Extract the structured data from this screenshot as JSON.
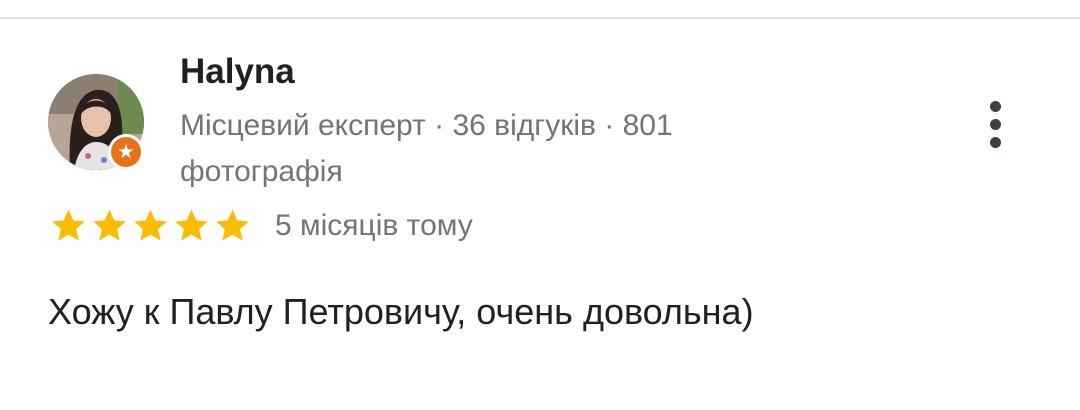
{
  "review": {
    "author": {
      "name": "Halyna",
      "meta": "Місцевий експерт · 36 відгуків · 801 фотографія",
      "avatar_icon": "user-photo-avatar",
      "badge_icon": "local-guide-badge-icon"
    },
    "rating": {
      "value": 5,
      "max": 5,
      "star_color": "#fbbc04"
    },
    "time": "5 місяців тому",
    "text": "Хожу к Павлу Петровичу, очень довольна)",
    "menu_icon": "more-vert-icon"
  },
  "colors": {
    "background": "#ffffff",
    "divider": "#e3e3e3",
    "primary_text": "#202124",
    "secondary_text": "#70757a",
    "badge": "#e8711c"
  }
}
